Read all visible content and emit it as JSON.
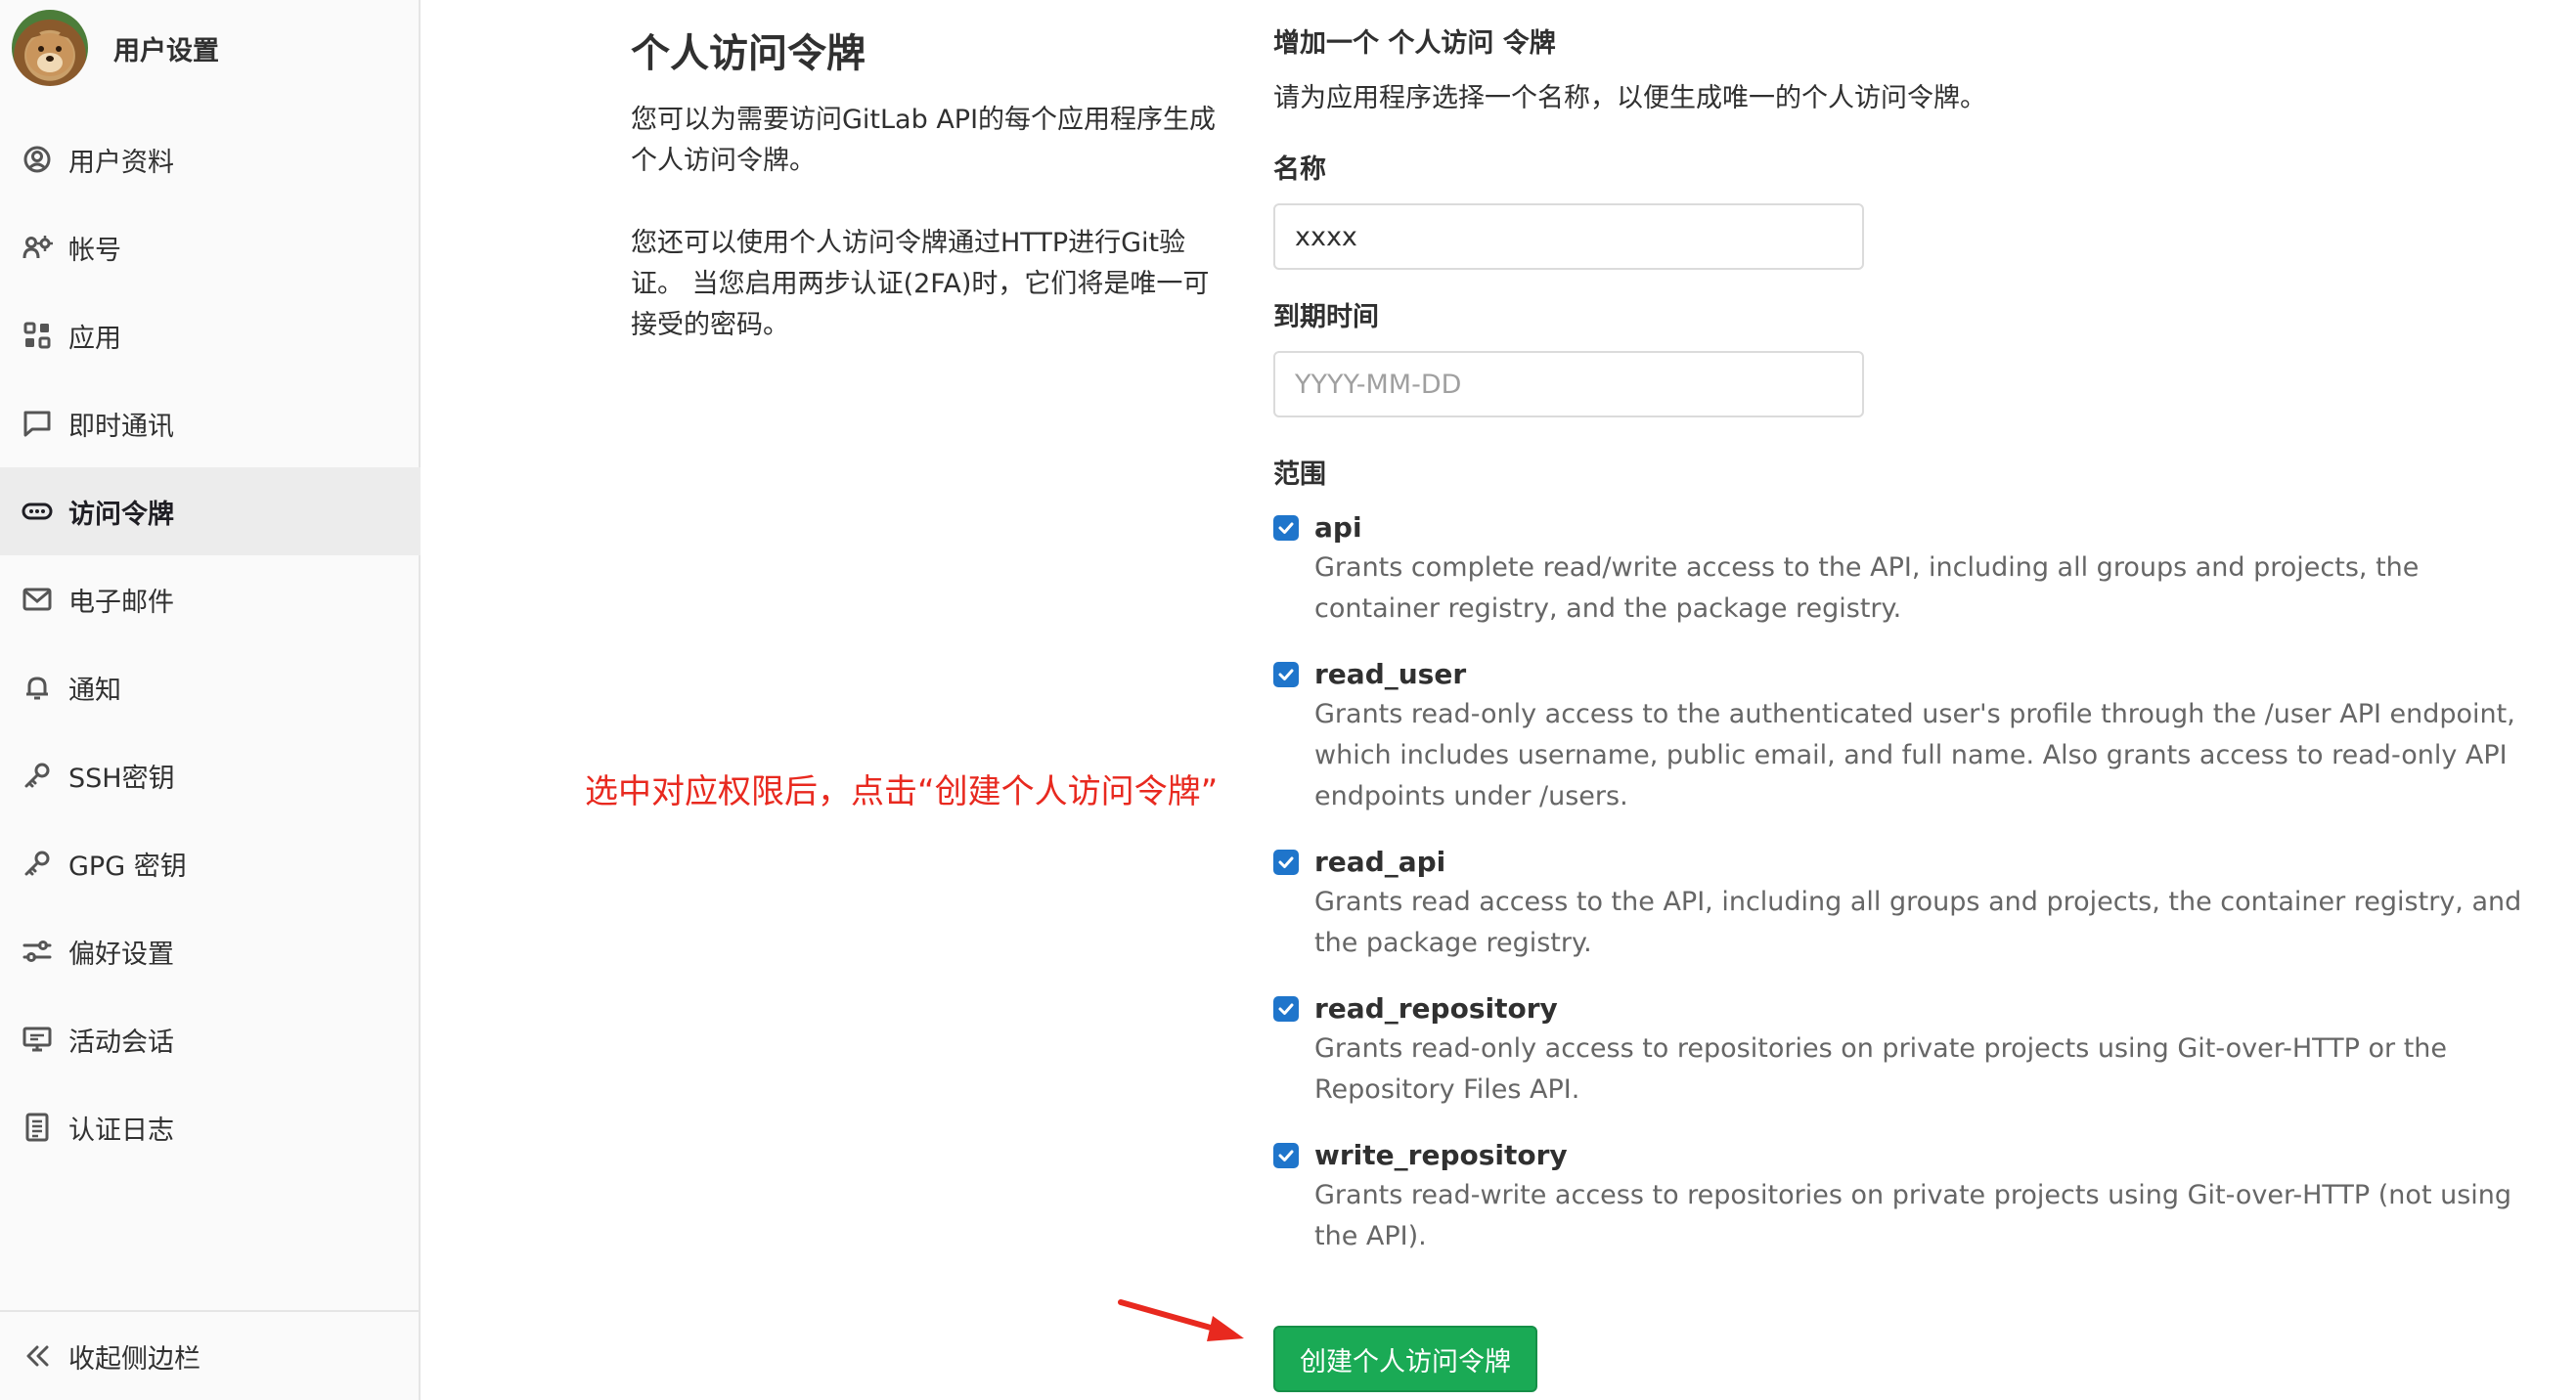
{
  "sidebar": {
    "title": "用户设置",
    "items": [
      {
        "label": "用户资料",
        "icon": "user-circle-icon",
        "active": false
      },
      {
        "label": "帐号",
        "icon": "account-gear-icon",
        "active": false
      },
      {
        "label": "应用",
        "icon": "applications-grid-icon",
        "active": false
      },
      {
        "label": "即时通讯",
        "icon": "chat-bubble-icon",
        "active": false
      },
      {
        "label": "访问令牌",
        "icon": "token-icon",
        "active": true
      },
      {
        "label": "电子邮件",
        "icon": "mail-icon",
        "active": false
      },
      {
        "label": "通知",
        "icon": "bell-icon",
        "active": false
      },
      {
        "label": "SSH密钥",
        "icon": "key-icon",
        "active": false
      },
      {
        "label": "GPG 密钥",
        "icon": "key-icon",
        "active": false
      },
      {
        "label": "偏好设置",
        "icon": "preferences-icon",
        "active": false
      },
      {
        "label": "活动会话",
        "icon": "monitor-icon",
        "active": false
      },
      {
        "label": "认证日志",
        "icon": "log-icon",
        "active": false
      }
    ],
    "collapse_label": "收起侧边栏"
  },
  "description": {
    "title": "个人访问令牌",
    "para1": "您可以为需要访问GitLab API的每个应用程序生成个人访问令牌。",
    "para2": "您还可以使用个人访问令牌通过HTTP进行Git验证。 当您启用两步认证(2FA)时，它们将是唯一可接受的密码。"
  },
  "form": {
    "heading": "增加一个 个人访问 令牌",
    "subheading": "请为应用程序选择一个名称，以便生成唯一的个人访问令牌。",
    "name_label": "名称",
    "name_value": "xxxx",
    "expiry_label": "到期时间",
    "expiry_placeholder": "YYYY-MM-DD",
    "scopes_label": "范围",
    "scopes": [
      {
        "name": "api",
        "checked": true,
        "help": "Grants complete read/write access to the API, including all groups and projects, the container registry, and the package registry."
      },
      {
        "name": "read_user",
        "checked": true,
        "help": "Grants read-only access to the authenticated user's profile through the /user API endpoint, which includes username, public email, and full name. Also grants access to read-only API endpoints under /users."
      },
      {
        "name": "read_api",
        "checked": true,
        "help": "Grants read access to the API, including all groups and projects, the container registry, and the package registry."
      },
      {
        "name": "read_repository",
        "checked": true,
        "help": "Grants read-only access to repositories on private projects using Git-over-HTTP or the Repository Files API."
      },
      {
        "name": "write_repository",
        "checked": true,
        "help": "Grants read-write access to repositories on private projects using Git-over-HTTP (not using the API)."
      }
    ],
    "submit_label": "创建个人访问令牌"
  },
  "annotation": "选中对应权限后，点击“创建个人访问令牌”",
  "colors": {
    "accent": "#1f75cb",
    "submit": "#1aaa55",
    "annotation": "#e8291f"
  }
}
